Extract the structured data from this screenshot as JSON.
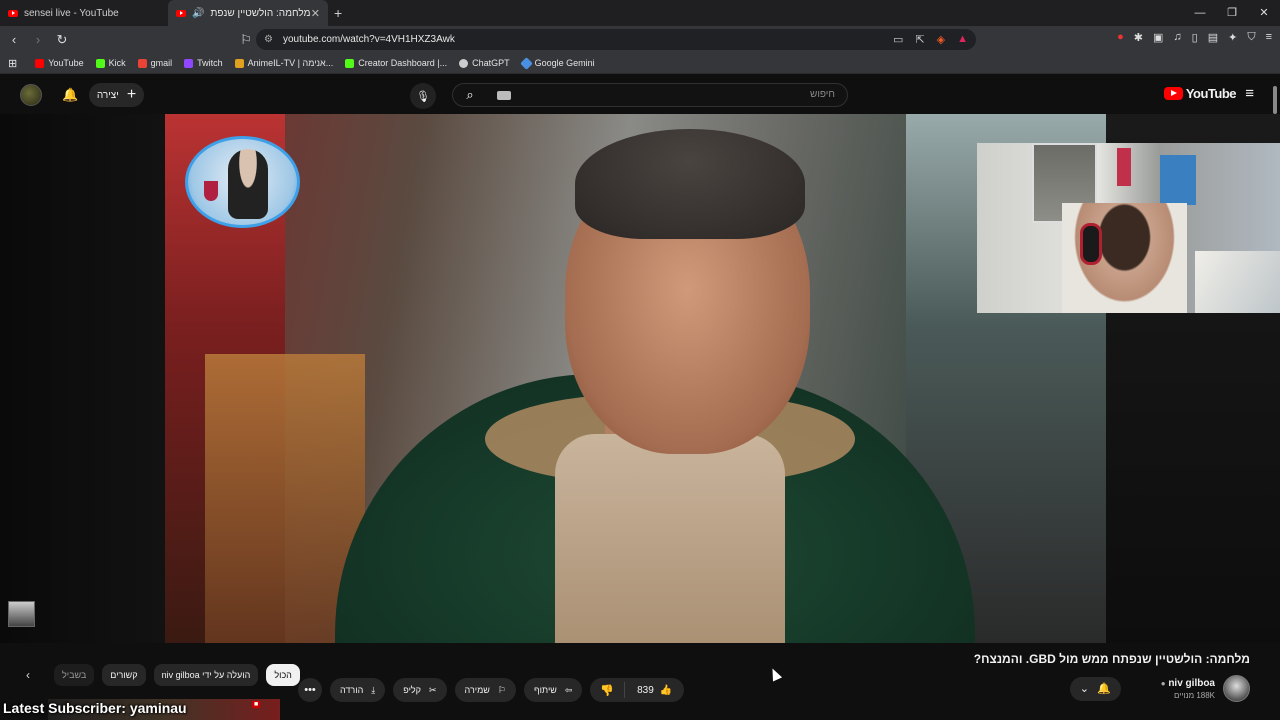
{
  "browser": {
    "tabs": [
      {
        "label": "sensei live - YouTube"
      },
      {
        "label": "מלחמה: הולשטיין שנפתח ממ..."
      }
    ],
    "url": "youtube.com/watch?v=4VH1HXZ3Awk",
    "bookmarks": [
      {
        "label": "YouTube",
        "color": "#ff0000"
      },
      {
        "label": "Kick",
        "color": "#53fc18"
      },
      {
        "label": "gmail",
        "color": "#ea4335"
      },
      {
        "label": "Twitch",
        "color": "#9146ff"
      },
      {
        "label": "AnimeIL-TV | אנימה...",
        "color": "#e0a020"
      },
      {
        "label": "Creator Dashboard |...",
        "color": "#ff0000"
      },
      {
        "label": "ChatGPT",
        "color": "#cccccc"
      },
      {
        "label": "Google Gemini",
        "color": "#4a90e2"
      }
    ]
  },
  "header": {
    "create_label": "יצירה",
    "search_placeholder": "חיפוש",
    "logo_text": "YouTube"
  },
  "video": {
    "title": "מלחמה: הולשטיין שנפתח ממש מול GBD. והמנצח?",
    "likes": "839",
    "channel": {
      "name": "niv gilboa",
      "subscribers": "188K מנויים"
    },
    "actions": {
      "share": "שיתוף",
      "save": "שמירה",
      "clip": "קליפ",
      "download": "הורדה"
    }
  },
  "chips": [
    {
      "label": "הכול",
      "active": true
    },
    {
      "label": "הועלה על ידי niv gilboa",
      "active": false
    },
    {
      "label": "קשורים",
      "active": false
    },
    {
      "label": "בשביל",
      "active": false
    }
  ],
  "stream_overlay": {
    "text": "Latest Subscriber: yaminau"
  }
}
